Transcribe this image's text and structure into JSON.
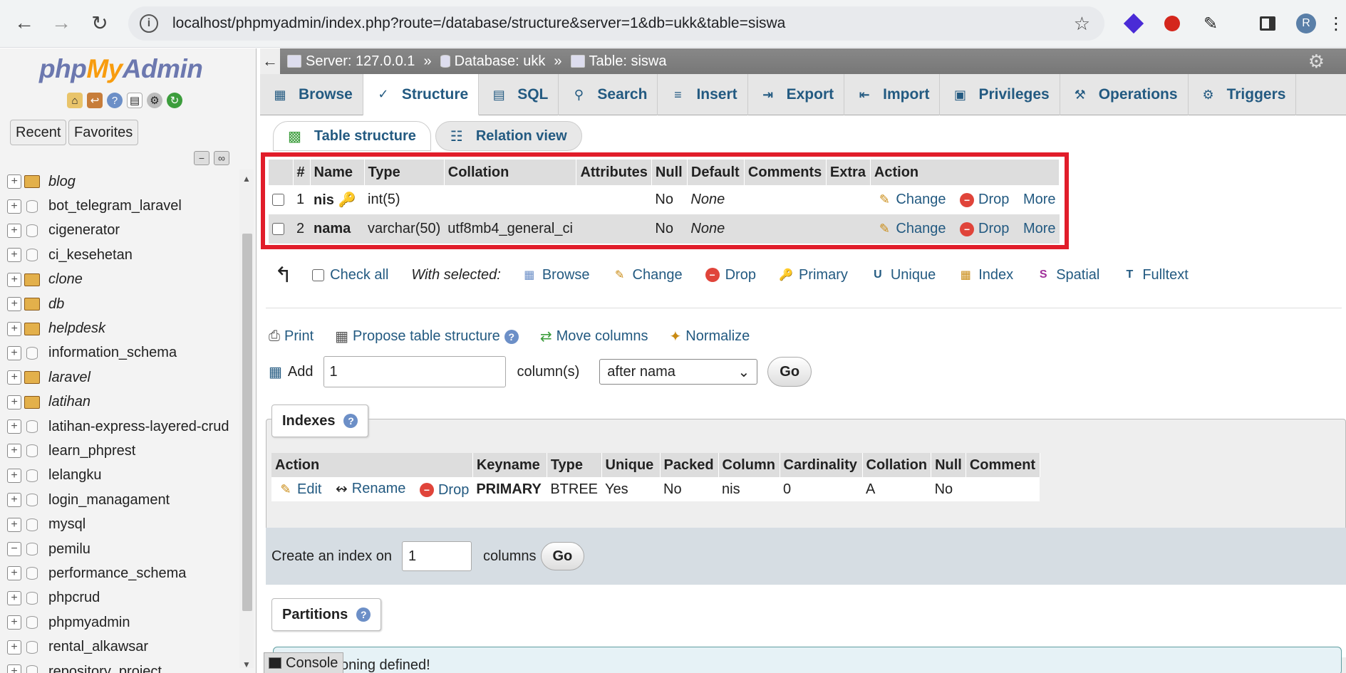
{
  "browser": {
    "url": "localhost/phpmyadmin/index.php?route=/database/structure&server=1&db=ukk&table=siswa",
    "profile_initial": "R"
  },
  "sidebar": {
    "logo": {
      "php": "php",
      "my": "My",
      "admin": "Admin"
    },
    "recent_label": "Recent",
    "favorites_label": "Favorites",
    "databases": [
      {
        "name": "blog",
        "italic": true
      },
      {
        "name": "bot_telegram_laravel",
        "italic": false
      },
      {
        "name": "cigenerator",
        "italic": false
      },
      {
        "name": "ci_kesehetan",
        "italic": false
      },
      {
        "name": "clone",
        "italic": true
      },
      {
        "name": "db",
        "italic": true
      },
      {
        "name": "helpdesk",
        "italic": true
      },
      {
        "name": "information_schema",
        "italic": false
      },
      {
        "name": "laravel",
        "italic": true
      },
      {
        "name": "latihan",
        "italic": true
      },
      {
        "name": "latihan-express-layered-crud",
        "italic": false
      },
      {
        "name": "learn_phprest",
        "italic": false
      },
      {
        "name": "lelangku",
        "italic": false
      },
      {
        "name": "login_managament",
        "italic": false
      },
      {
        "name": "mysql",
        "italic": false
      },
      {
        "name": "pemilu",
        "italic": false
      },
      {
        "name": "performance_schema",
        "italic": false
      },
      {
        "name": "phpcrud",
        "italic": false
      },
      {
        "name": "phpmyadmin",
        "italic": false
      },
      {
        "name": "rental_alkawsar",
        "italic": false
      },
      {
        "name": "repository_project",
        "italic": false
      }
    ]
  },
  "breadcrumb": {
    "server": "Server: 127.0.0.1",
    "database": "Database: ukk",
    "table": "Table: siswa",
    "separator": "»"
  },
  "tabs": [
    "Browse",
    "Structure",
    "SQL",
    "Search",
    "Insert",
    "Export",
    "Import",
    "Privileges",
    "Operations",
    "Triggers"
  ],
  "subtabs": {
    "table_structure": "Table structure",
    "relation_view": "Relation view"
  },
  "structure": {
    "headers": [
      "#",
      "Name",
      "Type",
      "Collation",
      "Attributes",
      "Null",
      "Default",
      "Comments",
      "Extra",
      "Action"
    ],
    "rows": [
      {
        "num": "1",
        "name": "nis",
        "type": "int(5)",
        "collation": "",
        "attributes": "",
        "null": "No",
        "default": "None",
        "comments": "",
        "extra": ""
      },
      {
        "num": "2",
        "name": "nama",
        "type": "varchar(50)",
        "collation": "utf8mb4_general_ci",
        "attributes": "",
        "null": "No",
        "default": "None",
        "comments": "",
        "extra": ""
      }
    ],
    "actions": {
      "change": "Change",
      "drop": "Drop",
      "more": "More"
    }
  },
  "with_selected": {
    "check_all": "Check all",
    "label": "With selected:",
    "items": [
      "Browse",
      "Change",
      "Drop",
      "Primary",
      "Unique",
      "Index",
      "Spatial",
      "Fulltext"
    ]
  },
  "links": {
    "print": "Print",
    "propose": "Propose table structure",
    "move": "Move columns",
    "normalize": "Normalize"
  },
  "add_columns": {
    "label": "Add",
    "value": "1",
    "suffix": "column(s)",
    "position": "after nama",
    "go": "Go"
  },
  "indexes": {
    "legend": "Indexes",
    "headers": [
      "Action",
      "Keyname",
      "Type",
      "Unique",
      "Packed",
      "Column",
      "Cardinality",
      "Collation",
      "Null",
      "Comment"
    ],
    "actions": {
      "edit": "Edit",
      "rename": "Rename",
      "drop": "Drop"
    },
    "row": {
      "keyname": "PRIMARY",
      "type": "BTREE",
      "unique": "Yes",
      "packed": "No",
      "column": "nis",
      "cardinality": "0",
      "collation": "A",
      "null": "No",
      "comment": ""
    },
    "create_label": "Create an index on",
    "create_value": "1",
    "create_suffix": "columns",
    "go": "Go"
  },
  "partitions": {
    "legend": "Partitions",
    "message": "No partitioning defined!"
  },
  "console_label": "Console"
}
